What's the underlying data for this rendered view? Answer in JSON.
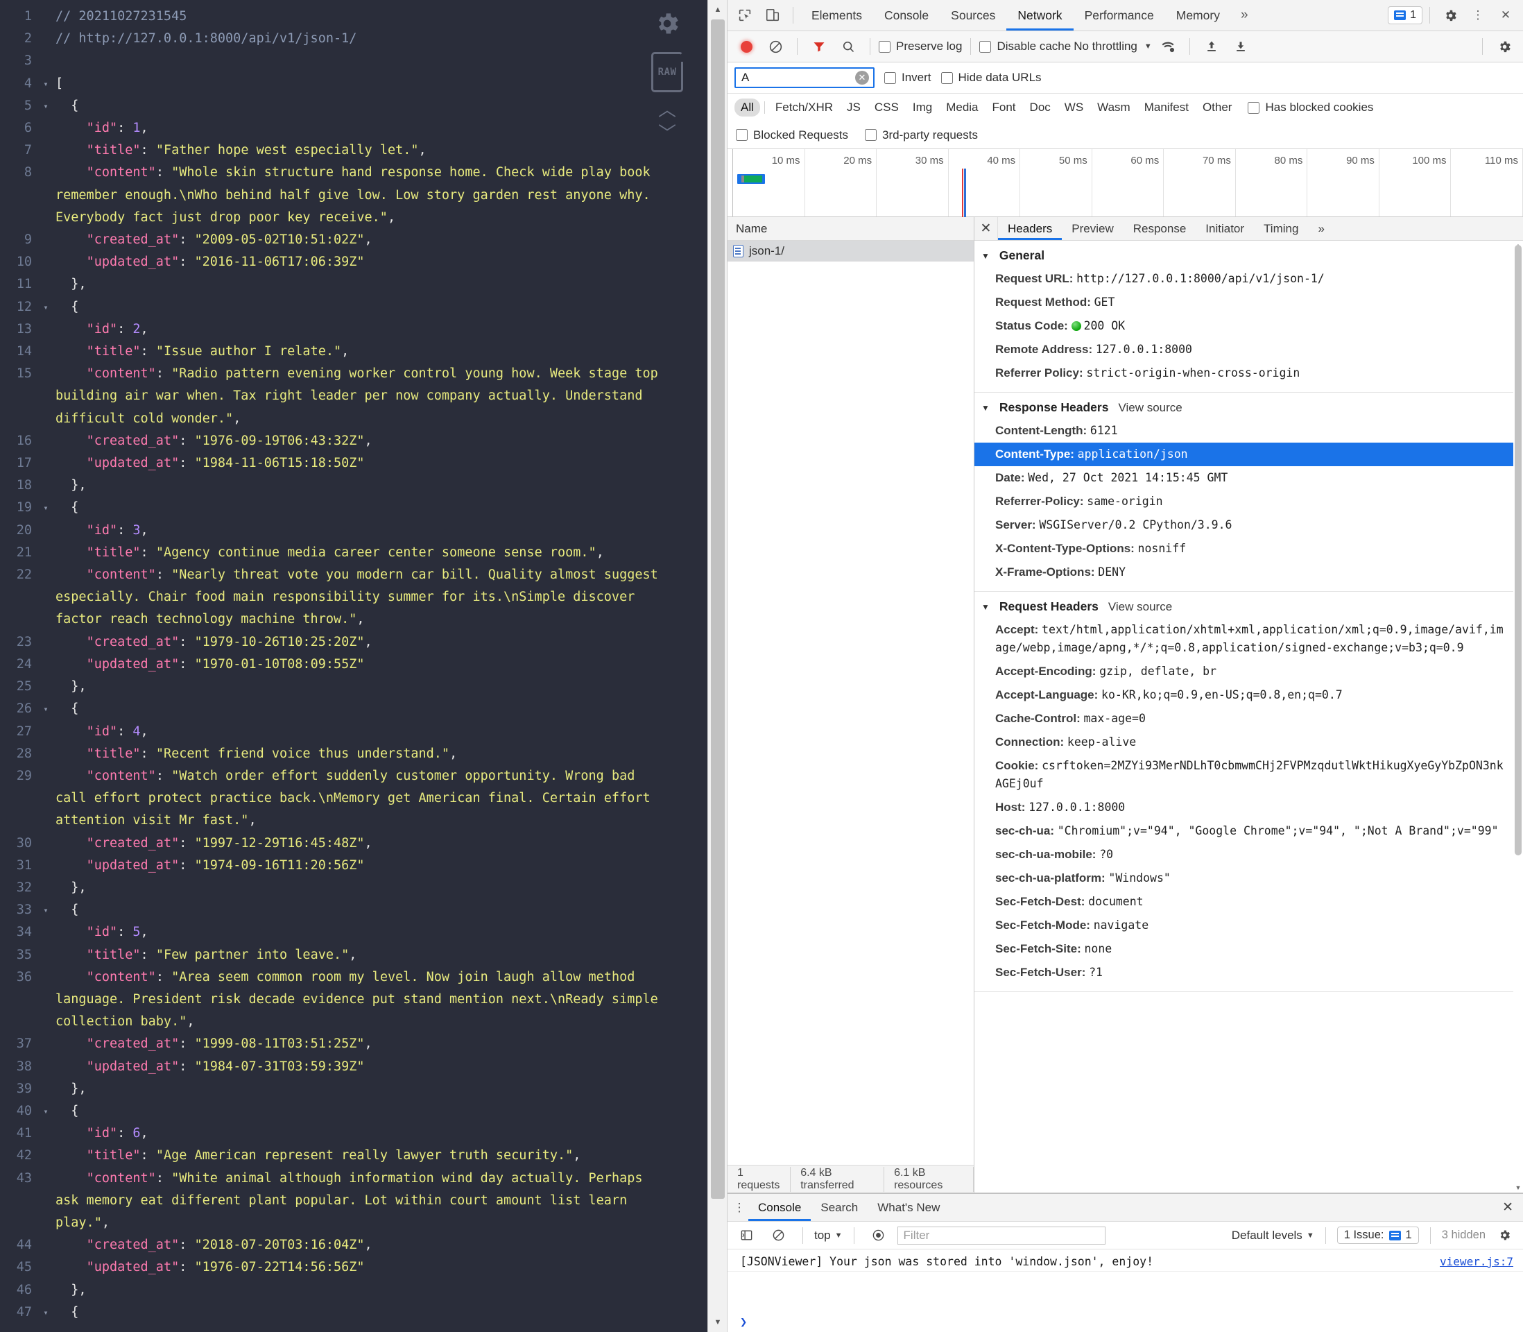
{
  "json_viewer": {
    "lines": [
      {
        "n": "1",
        "fold": "",
        "html": "<span class='k-comment'>// 20211027231545</span>"
      },
      {
        "n": "2",
        "fold": "",
        "html": "<span class='k-comment'>// http://127.0.0.1:8000/api/v1/json-1/</span>"
      },
      {
        "n": "3",
        "fold": "",
        "html": ""
      },
      {
        "n": "4",
        "fold": "▾",
        "html": "<span class='k-punc'>[</span>"
      },
      {
        "n": "5",
        "fold": "▾",
        "html": "  <span class='k-punc'>{</span>"
      },
      {
        "n": "6",
        "fold": "",
        "html": "    <span class='k-key'>\"id\"</span><span class='k-punc'>: </span><span class='k-num'>1</span><span class='k-punc'>,</span>"
      },
      {
        "n": "7",
        "fold": "",
        "html": "    <span class='k-key'>\"title\"</span><span class='k-punc'>: </span><span class='k-str'>\"Father hope west especially let.\"</span><span class='k-punc'>,</span>"
      },
      {
        "n": "8",
        "fold": "",
        "html": "    <span class='k-key'>\"content\"</span><span class='k-punc'>: </span><span class='k-str'>\"Whole skin structure hand response home. Check wide play book remember enough.\\nWho behind half give low. Low story garden rest anyone why. Everybody fact just drop poor key receive.\"</span><span class='k-punc'>,</span>"
      },
      {
        "n": "9",
        "fold": "",
        "html": "    <span class='k-key'>\"created_at\"</span><span class='k-punc'>: </span><span class='k-str'>\"2009-05-02T10:51:02Z\"</span><span class='k-punc'>,</span>"
      },
      {
        "n": "10",
        "fold": "",
        "html": "    <span class='k-key'>\"updated_at\"</span><span class='k-punc'>: </span><span class='k-str'>\"2016-11-06T17:06:39Z\"</span>"
      },
      {
        "n": "11",
        "fold": "",
        "html": "  <span class='k-punc'>},</span>"
      },
      {
        "n": "12",
        "fold": "▾",
        "html": "  <span class='k-punc'>{</span>"
      },
      {
        "n": "13",
        "fold": "",
        "html": "    <span class='k-key'>\"id\"</span><span class='k-punc'>: </span><span class='k-num'>2</span><span class='k-punc'>,</span>"
      },
      {
        "n": "14",
        "fold": "",
        "html": "    <span class='k-key'>\"title\"</span><span class='k-punc'>: </span><span class='k-str'>\"Issue author I relate.\"</span><span class='k-punc'>,</span>"
      },
      {
        "n": "15",
        "fold": "",
        "html": "    <span class='k-key'>\"content\"</span><span class='k-punc'>: </span><span class='k-str'>\"Radio pattern evening worker control young how. Week stage top building air war when. Tax right leader per now company actually. Understand difficult cold wonder.\"</span><span class='k-punc'>,</span>"
      },
      {
        "n": "16",
        "fold": "",
        "html": "    <span class='k-key'>\"created_at\"</span><span class='k-punc'>: </span><span class='k-str'>\"1976-09-19T06:43:32Z\"</span><span class='k-punc'>,</span>"
      },
      {
        "n": "17",
        "fold": "",
        "html": "    <span class='k-key'>\"updated_at\"</span><span class='k-punc'>: </span><span class='k-str'>\"1984-11-06T15:18:50Z\"</span>"
      },
      {
        "n": "18",
        "fold": "",
        "html": "  <span class='k-punc'>},</span>"
      },
      {
        "n": "19",
        "fold": "▾",
        "html": "  <span class='k-punc'>{</span>"
      },
      {
        "n": "20",
        "fold": "",
        "html": "    <span class='k-key'>\"id\"</span><span class='k-punc'>: </span><span class='k-num'>3</span><span class='k-punc'>,</span>"
      },
      {
        "n": "21",
        "fold": "",
        "html": "    <span class='k-key'>\"title\"</span><span class='k-punc'>: </span><span class='k-str'>\"Agency continue media career center someone sense room.\"</span><span class='k-punc'>,</span>"
      },
      {
        "n": "22",
        "fold": "",
        "html": "    <span class='k-key'>\"content\"</span><span class='k-punc'>: </span><span class='k-str'>\"Nearly threat vote you modern car bill. Quality almost suggest especially. Chair food main responsibility summer for its.\\nSimple discover factor reach technology machine throw.\"</span><span class='k-punc'>,</span>"
      },
      {
        "n": "23",
        "fold": "",
        "html": "    <span class='k-key'>\"created_at\"</span><span class='k-punc'>: </span><span class='k-str'>\"1979-10-26T10:25:20Z\"</span><span class='k-punc'>,</span>"
      },
      {
        "n": "24",
        "fold": "",
        "html": "    <span class='k-key'>\"updated_at\"</span><span class='k-punc'>: </span><span class='k-str'>\"1970-01-10T08:09:55Z\"</span>"
      },
      {
        "n": "25",
        "fold": "",
        "html": "  <span class='k-punc'>},</span>"
      },
      {
        "n": "26",
        "fold": "▾",
        "html": "  <span class='k-punc'>{</span>"
      },
      {
        "n": "27",
        "fold": "",
        "html": "    <span class='k-key'>\"id\"</span><span class='k-punc'>: </span><span class='k-num'>4</span><span class='k-punc'>,</span>"
      },
      {
        "n": "28",
        "fold": "",
        "html": "    <span class='k-key'>\"title\"</span><span class='k-punc'>: </span><span class='k-str'>\"Recent friend voice thus understand.\"</span><span class='k-punc'>,</span>"
      },
      {
        "n": "29",
        "fold": "",
        "html": "    <span class='k-key'>\"content\"</span><span class='k-punc'>: </span><span class='k-str'>\"Watch order effort suddenly customer opportunity. Wrong bad call effort protect practice back.\\nMemory get American final. Certain effort attention visit Mr fast.\"</span><span class='k-punc'>,</span>"
      },
      {
        "n": "30",
        "fold": "",
        "html": "    <span class='k-key'>\"created_at\"</span><span class='k-punc'>: </span><span class='k-str'>\"1997-12-29T16:45:48Z\"</span><span class='k-punc'>,</span>"
      },
      {
        "n": "31",
        "fold": "",
        "html": "    <span class='k-key'>\"updated_at\"</span><span class='k-punc'>: </span><span class='k-str'>\"1974-09-16T11:20:56Z\"</span>"
      },
      {
        "n": "32",
        "fold": "",
        "html": "  <span class='k-punc'>},</span>"
      },
      {
        "n": "33",
        "fold": "▾",
        "html": "  <span class='k-punc'>{</span>"
      },
      {
        "n": "34",
        "fold": "",
        "html": "    <span class='k-key'>\"id\"</span><span class='k-punc'>: </span><span class='k-num'>5</span><span class='k-punc'>,</span>"
      },
      {
        "n": "35",
        "fold": "",
        "html": "    <span class='k-key'>\"title\"</span><span class='k-punc'>: </span><span class='k-str'>\"Few partner into leave.\"</span><span class='k-punc'>,</span>"
      },
      {
        "n": "36",
        "fold": "",
        "html": "    <span class='k-key'>\"content\"</span><span class='k-punc'>: </span><span class='k-str'>\"Area seem common room my level. Now join laugh allow method language. President risk decade evidence put stand mention next.\\nReady simple collection baby.\"</span><span class='k-punc'>,</span>"
      },
      {
        "n": "37",
        "fold": "",
        "html": "    <span class='k-key'>\"created_at\"</span><span class='k-punc'>: </span><span class='k-str'>\"1999-08-11T03:51:25Z\"</span><span class='k-punc'>,</span>"
      },
      {
        "n": "38",
        "fold": "",
        "html": "    <span class='k-key'>\"updated_at\"</span><span class='k-punc'>: </span><span class='k-str'>\"1984-07-31T03:59:39Z\"</span>"
      },
      {
        "n": "39",
        "fold": "",
        "html": "  <span class='k-punc'>},</span>"
      },
      {
        "n": "40",
        "fold": "▾",
        "html": "  <span class='k-punc'>{</span>"
      },
      {
        "n": "41",
        "fold": "",
        "html": "    <span class='k-key'>\"id\"</span><span class='k-punc'>: </span><span class='k-num'>6</span><span class='k-punc'>,</span>"
      },
      {
        "n": "42",
        "fold": "",
        "html": "    <span class='k-key'>\"title\"</span><span class='k-punc'>: </span><span class='k-str'>\"Age American represent really lawyer truth security.\"</span><span class='k-punc'>,</span>"
      },
      {
        "n": "43",
        "fold": "",
        "html": "    <span class='k-key'>\"content\"</span><span class='k-punc'>: </span><span class='k-str'>\"White animal although information wind day actually. Perhaps ask memory eat different plant popular. Lot within court amount list learn play.\"</span><span class='k-punc'>,</span>"
      },
      {
        "n": "44",
        "fold": "",
        "html": "    <span class='k-key'>\"created_at\"</span><span class='k-punc'>: </span><span class='k-str'>\"2018-07-20T03:16:04Z\"</span><span class='k-punc'>,</span>"
      },
      {
        "n": "45",
        "fold": "",
        "html": "    <span class='k-key'>\"updated_at\"</span><span class='k-punc'>: </span><span class='k-str'>\"1976-07-22T14:56:56Z\"</span>"
      },
      {
        "n": "46",
        "fold": "",
        "html": "  <span class='k-punc'>},</span>"
      },
      {
        "n": "47",
        "fold": "▾",
        "html": "  <span class='k-punc'>{</span>"
      }
    ],
    "raw_label": "RAW"
  },
  "devtools": {
    "topbar": {
      "tabs": [
        {
          "label": "Elements",
          "active": false
        },
        {
          "label": "Console",
          "active": false
        },
        {
          "label": "Sources",
          "active": false
        },
        {
          "label": "Network",
          "active": true
        },
        {
          "label": "Performance",
          "active": false
        },
        {
          "label": "Memory",
          "active": false
        }
      ],
      "more": "»",
      "issue_count": "1"
    },
    "toolbar": {
      "preserve_log": "Preserve log",
      "disable_cache": "Disable cache",
      "throttling": "No throttling"
    },
    "filter": {
      "value": "A",
      "placeholder": "Filter",
      "invert": "Invert",
      "hide_data_urls": "Hide data URLs"
    },
    "types": [
      "All",
      "Fetch/XHR",
      "JS",
      "CSS",
      "Img",
      "Media",
      "Font",
      "Doc",
      "WS",
      "Wasm",
      "Manifest",
      "Other"
    ],
    "active_type": "All",
    "has_blocked_cookies": "Has blocked cookies",
    "blocked_requests": "Blocked Requests",
    "third_party_requests": "3rd-party requests",
    "timeline_ticks": [
      "10 ms",
      "20 ms",
      "30 ms",
      "40 ms",
      "50 ms",
      "60 ms",
      "70 ms",
      "80 ms",
      "90 ms",
      "100 ms",
      "110 ms"
    ],
    "request_list": {
      "column_header": "Name",
      "rows": [
        {
          "name": "json-1/",
          "selected": true
        }
      ],
      "footer": [
        "1 requests",
        "6.4 kB transferred",
        "6.1 kB resources"
      ]
    },
    "detail": {
      "tabs": [
        {
          "label": "Headers",
          "active": true
        },
        {
          "label": "Preview",
          "active": false
        },
        {
          "label": "Response",
          "active": false
        },
        {
          "label": "Initiator",
          "active": false
        },
        {
          "label": "Timing",
          "active": false
        }
      ],
      "more": "»",
      "sections": [
        {
          "title": "General",
          "view_source": "",
          "rows": [
            {
              "name": "Request URL:",
              "value": "http://127.0.0.1:8000/api/v1/json-1/",
              "selected": false,
              "status_dot": false
            },
            {
              "name": "Request Method:",
              "value": "GET",
              "selected": false,
              "status_dot": false
            },
            {
              "name": "Status Code:",
              "value": "200 OK",
              "selected": false,
              "status_dot": true
            },
            {
              "name": "Remote Address:",
              "value": "127.0.0.1:8000",
              "selected": false,
              "status_dot": false
            },
            {
              "name": "Referrer Policy:",
              "value": "strict-origin-when-cross-origin",
              "selected": false,
              "status_dot": false
            }
          ]
        },
        {
          "title": "Response Headers",
          "view_source": "View source",
          "rows": [
            {
              "name": "Content-Length:",
              "value": "6121",
              "selected": false,
              "status_dot": false
            },
            {
              "name": "Content-Type:",
              "value": "application/json",
              "selected": true,
              "status_dot": false
            },
            {
              "name": "Date:",
              "value": "Wed, 27 Oct 2021 14:15:45 GMT",
              "selected": false,
              "status_dot": false
            },
            {
              "name": "Referrer-Policy:",
              "value": "same-origin",
              "selected": false,
              "status_dot": false
            },
            {
              "name": "Server:",
              "value": "WSGIServer/0.2 CPython/3.9.6",
              "selected": false,
              "status_dot": false
            },
            {
              "name": "X-Content-Type-Options:",
              "value": "nosniff",
              "selected": false,
              "status_dot": false
            },
            {
              "name": "X-Frame-Options:",
              "value": "DENY",
              "selected": false,
              "status_dot": false
            }
          ]
        },
        {
          "title": "Request Headers",
          "view_source": "View source",
          "rows": [
            {
              "name": "Accept:",
              "value": "text/html,application/xhtml+xml,application/xml;q=0.9,image/avif,image/webp,image/apng,*/*;q=0.8,application/signed-exchange;v=b3;q=0.9",
              "selected": false,
              "status_dot": false
            },
            {
              "name": "Accept-Encoding:",
              "value": "gzip, deflate, br",
              "selected": false,
              "status_dot": false
            },
            {
              "name": "Accept-Language:",
              "value": "ko-KR,ko;q=0.9,en-US;q=0.8,en;q=0.7",
              "selected": false,
              "status_dot": false
            },
            {
              "name": "Cache-Control:",
              "value": "max-age=0",
              "selected": false,
              "status_dot": false
            },
            {
              "name": "Connection:",
              "value": "keep-alive",
              "selected": false,
              "status_dot": false
            },
            {
              "name": "Cookie:",
              "value": "csrftoken=2MZYi93MerNDLhT0cbmwmCHj2FVPMzqdutlWktHikugXyeGyYbZpON3nkAGEj0uf",
              "selected": false,
              "status_dot": false
            },
            {
              "name": "Host:",
              "value": "127.0.0.1:8000",
              "selected": false,
              "status_dot": false
            },
            {
              "name": "sec-ch-ua:",
              "value": "\"Chromium\";v=\"94\", \"Google Chrome\";v=\"94\", \";Not A Brand\";v=\"99\"",
              "selected": false,
              "status_dot": false
            },
            {
              "name": "sec-ch-ua-mobile:",
              "value": "?0",
              "selected": false,
              "status_dot": false
            },
            {
              "name": "sec-ch-ua-platform:",
              "value": "\"Windows\"",
              "selected": false,
              "status_dot": false
            },
            {
              "name": "Sec-Fetch-Dest:",
              "value": "document",
              "selected": false,
              "status_dot": false
            },
            {
              "name": "Sec-Fetch-Mode:",
              "value": "navigate",
              "selected": false,
              "status_dot": false
            },
            {
              "name": "Sec-Fetch-Site:",
              "value": "none",
              "selected": false,
              "status_dot": false
            },
            {
              "name": "Sec-Fetch-User:",
              "value": "?1",
              "selected": false,
              "status_dot": false
            }
          ]
        }
      ]
    },
    "drawer": {
      "tabs": [
        {
          "label": "Console",
          "active": true
        },
        {
          "label": "Search",
          "active": false
        },
        {
          "label": "What's New",
          "active": false
        }
      ],
      "context": "top",
      "filter_placeholder": "Filter",
      "levels": "Default levels",
      "issues": "1 Issue:",
      "issues_count": "1",
      "hidden": "3 hidden",
      "messages": [
        {
          "text": "[JSONViewer] Your json was stored into 'window.json', enjoy!",
          "source": "viewer.js:7"
        }
      ],
      "prompt": "❯"
    }
  },
  "colors": {
    "accent": "#1a73e8",
    "record": "#e8413a",
    "status_ok": "#0ea50e",
    "json_bg": "#2a2d3a",
    "json_string": "#e8ea7e",
    "json_key": "#ff7bb0",
    "json_number": "#b48cff"
  }
}
